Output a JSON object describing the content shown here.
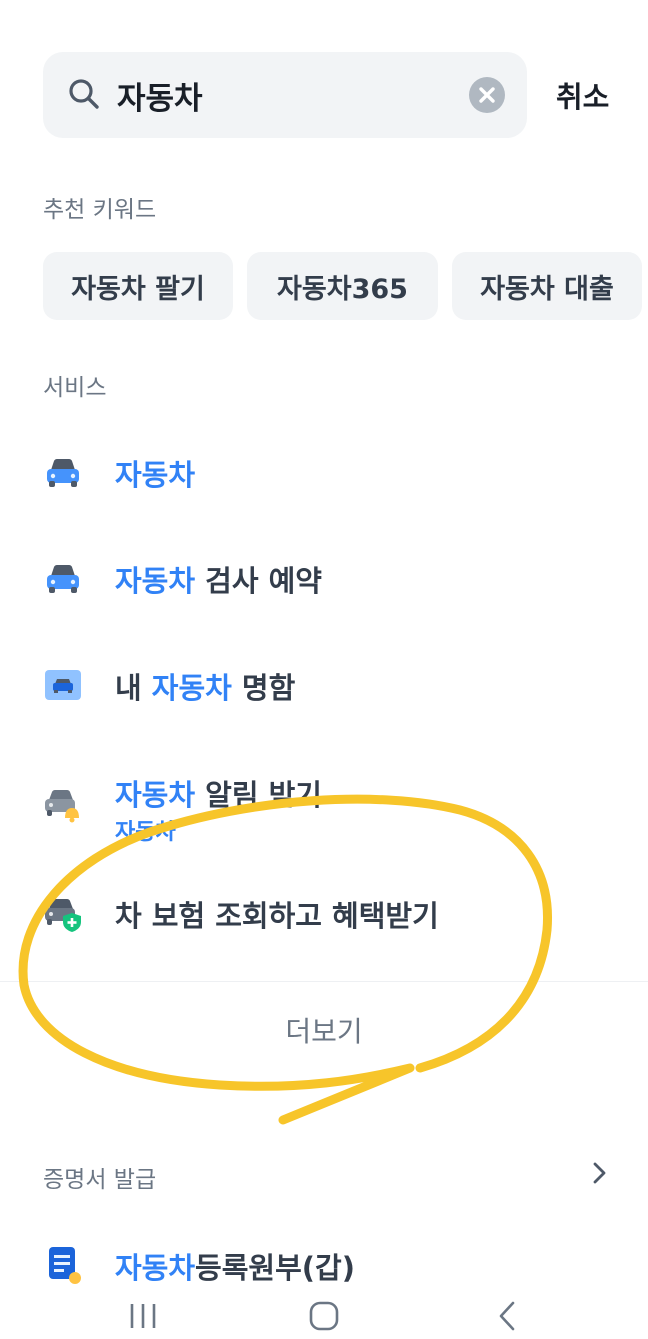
{
  "status_bar": {
    "left_fragment": "",
    "right_fragment": ""
  },
  "search": {
    "value": "자동차",
    "cancel_label": "취소"
  },
  "recommended": {
    "title": "추천 키워드",
    "chips": [
      "자동차 팔기",
      "자동차365",
      "자동차 대출"
    ]
  },
  "services": {
    "title": "서비스",
    "items": [
      {
        "icon": "car-icon",
        "prefix": "",
        "highlight": "자동차",
        "suffix": ""
      },
      {
        "icon": "car-icon",
        "prefix": "",
        "highlight": "자동차",
        "suffix": " 검사 예약"
      },
      {
        "icon": "car-card-icon",
        "prefix": "내 ",
        "highlight": "자동차",
        "suffix": " 명함"
      },
      {
        "icon": "car-alert-icon",
        "prefix": "",
        "highlight": "자동차",
        "suffix": " 알림 받기",
        "sub": "자동차"
      },
      {
        "icon": "car-insurance-icon",
        "prefix": "",
        "highlight": "",
        "suffix": "차 보험 조회하고 혜택받기"
      }
    ],
    "more_label": "더보기"
  },
  "certificates": {
    "title": "증명서 발급",
    "item": {
      "icon": "document-icon",
      "highlight": "자동차",
      "suffix": "등록원부(갑)"
    }
  },
  "colors": {
    "accent": "#3182f6",
    "annotation": "#f7c52a",
    "chip_bg": "#f2f4f6"
  }
}
